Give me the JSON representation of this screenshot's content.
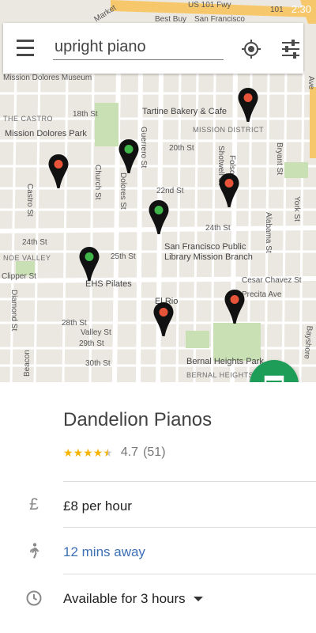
{
  "status_bar": {
    "time": "2:30"
  },
  "search": {
    "menu_icon": "hamburger-menu-icon",
    "value": "upright piano",
    "locate_icon": "gps-locate-icon",
    "filter_icon": "tune-filter-icon"
  },
  "map": {
    "labels": {
      "market_st": "Market",
      "freeway": "US 101 Fwy",
      "best_buy": "Best Buy",
      "sf_label": "San Francisco",
      "hwy_101": "101",
      "mission_dolores_museum": "Mission Dolores Museum",
      "castro": "THE CASTRO",
      "st18": "18th St",
      "tartine": "Tartine Bakery & Cafe",
      "mission_district": "MISSION DISTRICT",
      "mission_dolores_park": "Mission Dolores Park",
      "st20": "20th St",
      "st22": "22nd St",
      "guerrero": "Guerrero St",
      "dolores": "Dolores St",
      "church": "Church St",
      "castro_st": "Castro St",
      "st24a": "24th St",
      "st24b": "24th St",
      "st25": "25th St",
      "noe_valley": "NOE VALLEY",
      "clipper": "Clipper St",
      "library": "San Francisco Public Library Mission Branch",
      "ehs": "EHS Pilates",
      "cesar_chavez": "Cesar Chavez St",
      "st28": "28th St",
      "valley": "Valley St",
      "st29": "29th St",
      "st30": "30th St",
      "diamond": "Diamond St",
      "el_rio": "El Rio",
      "precita": "Precita Ave",
      "bernal_park": "Bernal Heights Park",
      "bernal": "BERNAL HEIGHTS",
      "york": "York St",
      "bryant": "Bryant St",
      "alabama": "Alabama St",
      "folsom": "Folsom St",
      "shotwell": "Shotwell St",
      "bayshore": "Bayshore",
      "beacon": "Beacon",
      "fifth_ave": "Ave"
    },
    "pins": [
      {
        "name": "pin-1",
        "status": "available",
        "color": "#e8543a"
      },
      {
        "name": "pin-2",
        "status": "selected",
        "color": "#3fb54a"
      },
      {
        "name": "pin-3",
        "status": "available",
        "color": "#e8543a"
      },
      {
        "name": "pin-4",
        "status": "available",
        "color": "#e8543a"
      },
      {
        "name": "pin-5",
        "status": "selected",
        "color": "#3fb54a"
      },
      {
        "name": "pin-6",
        "status": "selected",
        "color": "#3fb54a"
      },
      {
        "name": "pin-7",
        "status": "available",
        "color": "#e8543a"
      },
      {
        "name": "pin-8",
        "status": "available",
        "color": "#e8543a"
      }
    ]
  },
  "fab": {
    "icon": "open-in-new-panel-icon",
    "color": "#1e9d58"
  },
  "place": {
    "name": "Dandelion Pianos",
    "rating": 4.7,
    "rating_text": "4.7",
    "review_count": "(51)",
    "price_icon": "pound-sterling-icon",
    "price_icon_glyph": "£",
    "price": "£8 per hour",
    "distance_icon": "walking-person-icon",
    "distance": "12 mins away",
    "availability_icon": "clock-icon",
    "availability": "Available for 3 hours",
    "dropdown_icon": "dropdown-arrow-icon"
  },
  "colors": {
    "accent": "#1e9d58",
    "link": "#3b6fb6",
    "star": "#f4b400",
    "pin_red": "#e8543a",
    "pin_green": "#3fb54a"
  }
}
